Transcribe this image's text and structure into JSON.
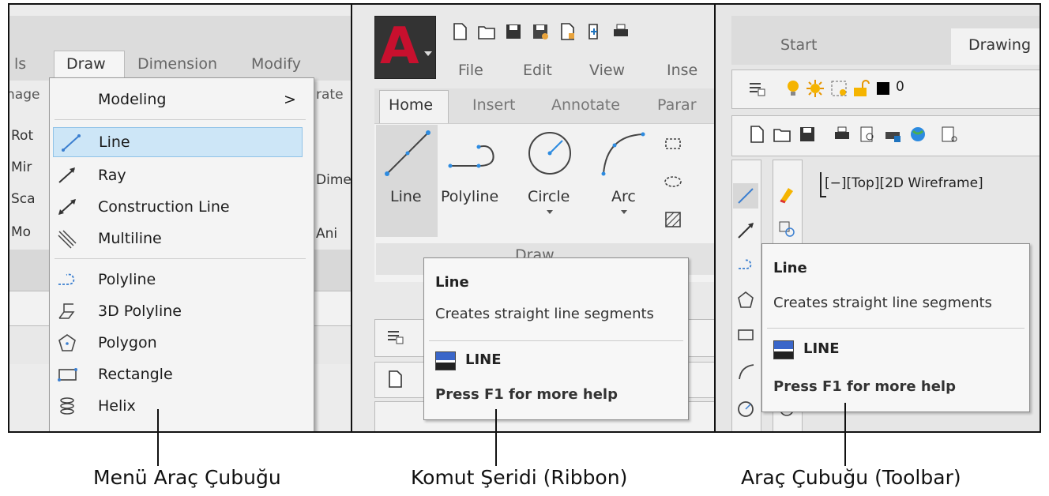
{
  "panel1": {
    "tabs": {
      "ls": "ls",
      "draw": "Draw",
      "dimension": "Dimension",
      "modify": "Modify"
    },
    "bg_labels": {
      "nag": "nage",
      "rot": "Rot",
      "mir": "Mir",
      "sca": "Sca",
      "mod": "Mo",
      "rate": "rate",
      "dime": "Dime",
      "ani": "Ani"
    },
    "menu_items": [
      {
        "label": "Modeling",
        "arrow": ">",
        "icon": ""
      },
      {
        "label": "Line",
        "icon": "line-icon"
      },
      {
        "label": "Ray",
        "icon": "ray-icon"
      },
      {
        "label": "Construction Line",
        "icon": "construction-line-icon"
      },
      {
        "label": "Multiline",
        "icon": "multiline-icon"
      },
      {
        "label": "Polyline",
        "icon": "polyline-icon"
      },
      {
        "label": "3D Polyline",
        "icon": "3d-polyline-icon"
      },
      {
        "label": "Polygon",
        "icon": "polygon-icon"
      },
      {
        "label": "Rectangle",
        "icon": "rectangle-icon"
      },
      {
        "label": "Helix",
        "icon": "helix-icon"
      }
    ],
    "caption": "Menü Araç Çubuğu"
  },
  "panel2": {
    "app_letter": "A",
    "menubar": {
      "file": "File",
      "edit": "Edit",
      "view": "View",
      "insert": "Inse"
    },
    "ribbon_tabs": {
      "home": "Home",
      "insert": "Insert",
      "annotate": "Annotate",
      "param": "Parar"
    },
    "tools": {
      "line": "Line",
      "polyline": "Polyline",
      "circle": "Circle",
      "arc": "Arc"
    },
    "panel_title": "Draw",
    "tooltip": {
      "title": "Line",
      "desc": "Creates straight line segments",
      "command": "LINE",
      "help": "Press F1 for more help"
    },
    "caption": "Komut Şeridi (Ribbon)"
  },
  "panel3": {
    "tabs": {
      "start": "Start",
      "drawing": "Drawing"
    },
    "layer_value": "0",
    "viewport_label": "[−][Top][2D Wireframe]",
    "tooltip": {
      "title": "Line",
      "desc": "Creates straight line segments",
      "command": "LINE",
      "help": "Press F1 for more help"
    },
    "caption": "Araç Çubuğu (Toolbar)"
  },
  "colors": {
    "highlight": "#cde6f7",
    "autocad_red": "#c8102e",
    "ribbon_bg": "#f0f0f0"
  }
}
